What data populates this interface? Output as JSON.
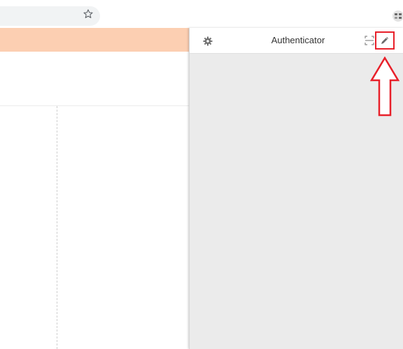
{
  "browser": {
    "icons": {
      "bookmark": "star-icon",
      "extension": "extension-icon"
    }
  },
  "popup": {
    "title": "Authenticator",
    "icons": {
      "settings": "gear-icon",
      "scan": "scan-qr-icon",
      "edit": "pencil-icon"
    }
  },
  "annotation": {
    "type": "up-arrow",
    "color": "#e8202a"
  },
  "colors": {
    "page_banner": "#fccfb2",
    "popup_body": "#ebebeb",
    "highlight": "#e8202a"
  }
}
